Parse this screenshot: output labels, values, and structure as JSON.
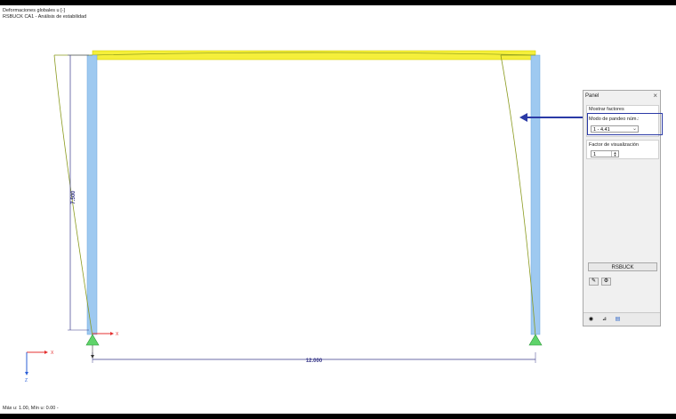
{
  "header": {
    "line1": "Deformaciones globales u [-]",
    "line2": "RSBUCK CA1 - Análisis de estabilidad"
  },
  "footer": {
    "text": "Máx u: 1.00, Mín u: 0.00 -"
  },
  "dimensions": {
    "height": "7.500",
    "width": "12.000"
  },
  "axes": {
    "x_label": "X",
    "z_label": "Z"
  },
  "panel": {
    "title": "Panel",
    "close": "×",
    "section_title": "Mostrar factores",
    "mode_label": "Modo de pandeo núm.:",
    "mode_value": "1 - 4.41",
    "factor_label": "Factor de visualización",
    "factor_value": "1",
    "rsbuck_button": "RSBUCK"
  },
  "colors": {
    "beam": "#f5ef3a",
    "column": "#9ec9f0",
    "support": "#5fd36a",
    "deformed": "#8a9a1e",
    "dimension": "#3a3a8a",
    "callout": "#2b3aa6"
  }
}
